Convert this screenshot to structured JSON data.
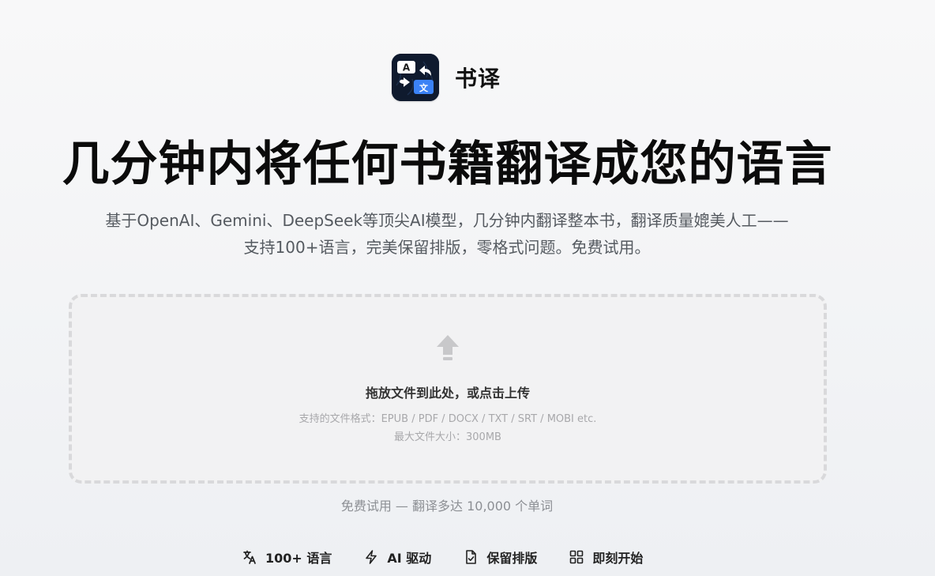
{
  "brand": {
    "name": "书译",
    "icon": "translate-app-icon",
    "icon_letters": {
      "latin": "A",
      "cjk": "文"
    }
  },
  "hero": {
    "headline": "几分钟内将任何书籍翻译成您的语言",
    "subtitle_line1": "基于OpenAI、Gemini、DeepSeek等顶尖AI模型，几分钟内翻译整本书，翻译质量媲美人工——",
    "subtitle_line2": "支持100+语言，完美保留排版，零格式问题。免费试用。"
  },
  "dropzone": {
    "icon": "upload-arrow-icon",
    "title": "拖放文件到此处，或点击上传",
    "formats": "支持的文件格式：EPUB / PDF / DOCX / TXT / SRT / MOBI etc.",
    "max_size": "最大文件大小：300MB"
  },
  "free_note": "免费试用 — 翻译多达 10,000 个单词",
  "features": [
    {
      "icon": "language-icon",
      "label": "100+ 语言"
    },
    {
      "icon": "lightning-icon",
      "label": "AI 驱动"
    },
    {
      "icon": "document-check-icon",
      "label": "保留排版"
    },
    {
      "icon": "grid-icon",
      "label": "即刻开始"
    }
  ],
  "colors": {
    "icon_bg": "#0f1a2e",
    "accent_blue": "#3b82f6",
    "dropzone_border": "#d9d9db"
  }
}
